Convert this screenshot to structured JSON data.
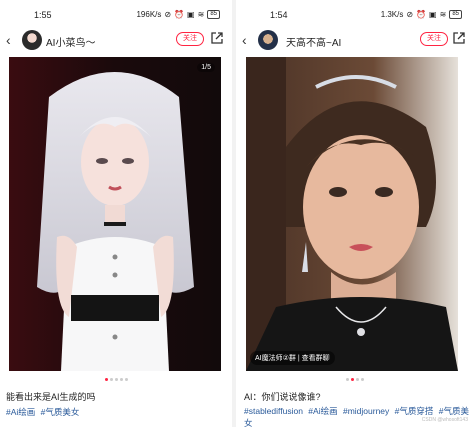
{
  "left": {
    "status": {
      "time": "1:55",
      "speed": "196K/s"
    },
    "user": {
      "name": "AI小菜鸟～",
      "follow_label": "关注"
    },
    "photo": {
      "pager": "1/5"
    },
    "caption": "能看出来是AI生成的吗",
    "tags": [
      "#Ai绘画",
      "#气质美女"
    ]
  },
  "right": {
    "status": {
      "time": "1:54",
      "speed": "1.3K/s"
    },
    "user": {
      "name": "天高不高~AI",
      "follow_label": "关注"
    },
    "photo": {
      "group_chip": "AI魔法师②群 | 查看群聊"
    },
    "caption": "AI：你们说说像谁?",
    "tags": [
      "#stablediffusion",
      "#Ai绘画",
      "#midjourney",
      "#气质穿搭",
      "#气质美女"
    ],
    "watermark": "CSDN @whosoft143"
  },
  "colors": {
    "accent": "#ff2442",
    "tag": "#2a5a9a"
  }
}
